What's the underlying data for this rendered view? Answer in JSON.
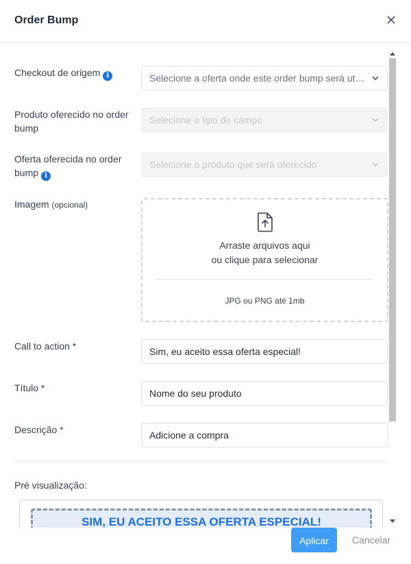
{
  "modal": {
    "title": "Order Bump"
  },
  "form": {
    "checkout": {
      "label": "Checkout de origem",
      "placeholder": "Selecione a oferta onde este order bump será util..."
    },
    "product": {
      "label": "Produto oferecido no order bump",
      "placeholder": "Selecione o tipo do campo"
    },
    "offer": {
      "label": "Oferta oferecida no order bump",
      "placeholder": "Selecione o produto que será oferecido"
    },
    "image": {
      "label": "Imagem",
      "optional": "(opcional)",
      "drop_line1": "Arraste arquivos aqui",
      "drop_line2": "ou clique para selecionar",
      "hint": "JPG ou PNG até 1mb"
    },
    "cta": {
      "label": "Call to action *",
      "value": "Sim, eu aceito essa oferta especial!"
    },
    "titulo": {
      "label": "Título *",
      "value": "Nome do seu produto"
    },
    "descricao": {
      "label": "Descrição *",
      "value": "Adicione a compra"
    }
  },
  "preview": {
    "label": "Pré visualização:",
    "cta_text": "SIM, EU ACEITO ESSA OFERTA ESPECIAL!"
  },
  "footer": {
    "apply_label": "Aplicar",
    "cancel_label": "Cancelar"
  },
  "colors": {
    "accent": "#3f9cf7",
    "info": "#1e6fd9",
    "preview_bg": "#e3ecf7"
  },
  "icons": {
    "close": "close-icon",
    "info": "info-icon",
    "chevron": "chevron-down-icon",
    "upload": "file-upload-icon"
  }
}
